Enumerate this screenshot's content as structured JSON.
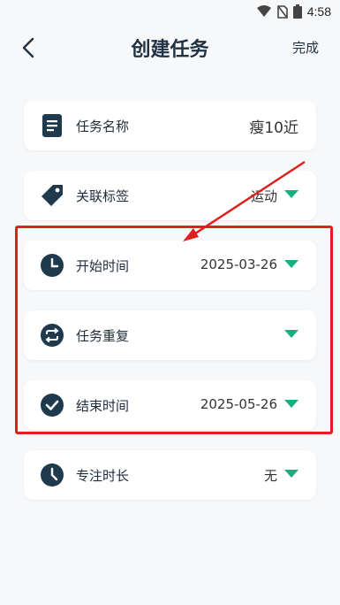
{
  "status_bar": {
    "time": "4:58"
  },
  "header": {
    "title": "创建任务",
    "done_label": "完成"
  },
  "items": [
    {
      "label": "任务名称",
      "value": "瘦10近",
      "icon": "document-icon"
    },
    {
      "label": "关联标签",
      "value": "运动",
      "icon": "tag-icon"
    },
    {
      "label": "开始时间",
      "value": "2025-03-26",
      "icon": "clock-icon"
    },
    {
      "label": "任务重复",
      "value": "",
      "icon": "repeat-icon"
    },
    {
      "label": "结束时间",
      "value": "2025-05-26",
      "icon": "check-circle-icon"
    },
    {
      "label": "专注时长",
      "value": "无",
      "icon": "timer-icon"
    }
  ],
  "colors": {
    "accent": "#18b07a",
    "icon_dark": "#1f3a4d",
    "annotation": "#e02020"
  }
}
